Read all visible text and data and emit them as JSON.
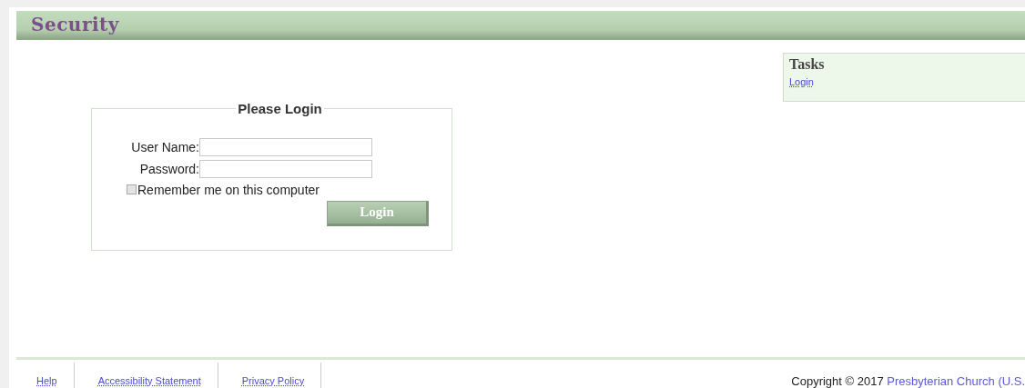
{
  "header": {
    "title": "Security"
  },
  "login": {
    "legend": "Please Login",
    "fields": [
      {
        "label": "User Name:"
      },
      {
        "label": "Password:"
      }
    ],
    "remember": {
      "label": "Remember me on this computer",
      "checked": false
    },
    "button": "Login"
  },
  "tasks": {
    "title": "Tasks",
    "links": [
      "Login"
    ]
  },
  "footer": {
    "links": [
      "Help",
      "Accessibility Statement",
      "Privacy Policy"
    ],
    "copyright": "Copyright © 2017",
    "owner_link": "Presbyterian Church (U.S."
  }
}
